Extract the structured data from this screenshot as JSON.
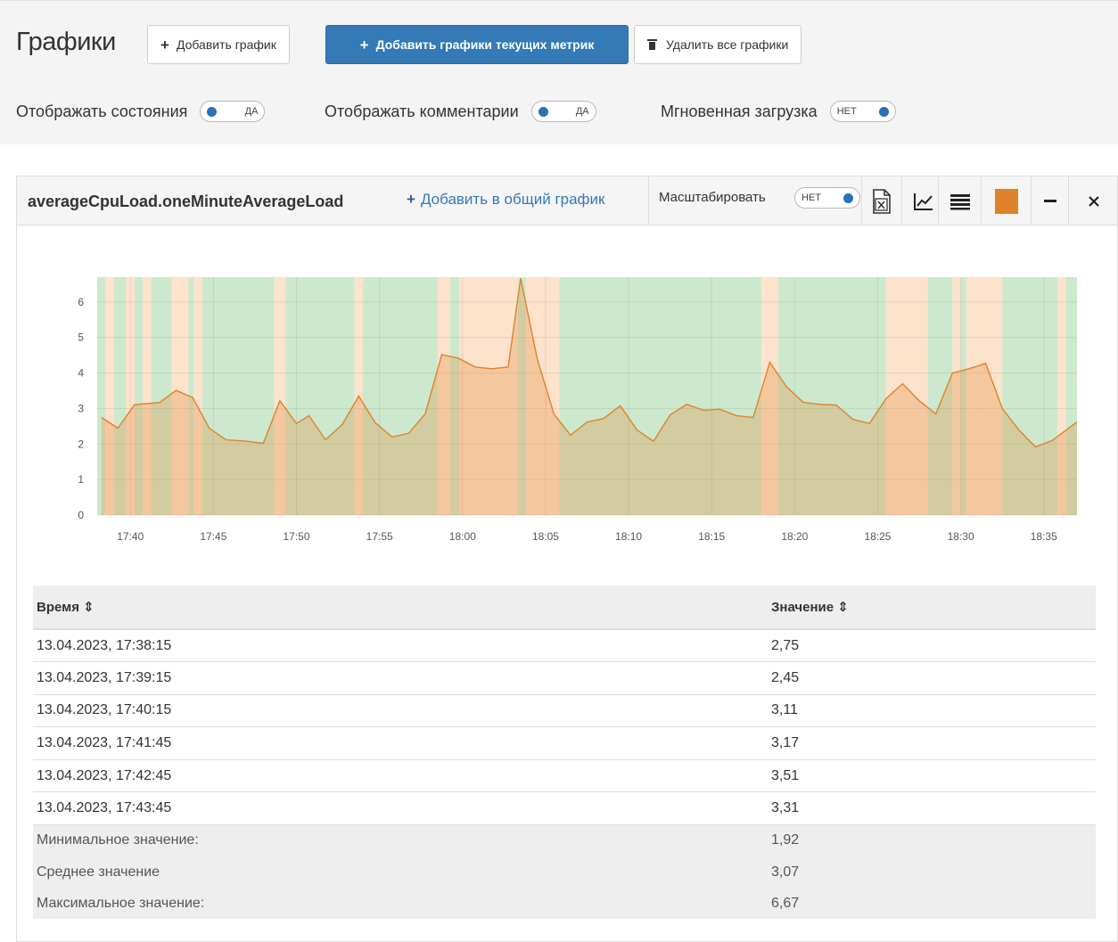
{
  "page": {
    "title": "Графики",
    "buttons": {
      "add_chart": "Добавить график",
      "add_current": "Добавить графики текущих метрик",
      "delete_all": "Удалить все графики"
    },
    "options": [
      {
        "label": "Отображать состояния",
        "state": "ДА"
      },
      {
        "label": "Отображать комментарии",
        "state": "ДА"
      },
      {
        "label": "Мгновенная загрузка",
        "state": "НЕТ"
      }
    ]
  },
  "panel": {
    "metric": "averageCpuLoad.oneMinuteAverageLoad",
    "add_to_common": "Добавить в общий график",
    "scale_label": "Масштабировать",
    "scale_state": "НЕТ",
    "tools": [
      "excel-export-icon",
      "line-chart-icon",
      "table-list-icon",
      "color-swatch-icon",
      "minimize-icon",
      "close-icon"
    ],
    "series_color": "#e0822a"
  },
  "chart_data": {
    "type": "area",
    "y_ticks": [
      "0",
      "1",
      "2",
      "3",
      "4",
      "5",
      "6"
    ],
    "ylim": [
      0,
      6.7
    ],
    "x_ticks": [
      "17:40",
      "17:45",
      "17:50",
      "17:55",
      "18:00",
      "18:05",
      "18:10",
      "18:15",
      "18:20",
      "18:25",
      "18:30",
      "18:35"
    ],
    "xlim": [
      "17:38",
      "18:37"
    ],
    "grid": true,
    "series": [
      {
        "color": "#e0822a",
        "points": [
          [
            "17:38:15",
            2.75
          ],
          [
            "17:39:15",
            2.45
          ],
          [
            "17:40:15",
            3.11
          ],
          [
            "17:41:45",
            3.17
          ],
          [
            "17:42:45",
            3.51
          ],
          [
            "17:43:45",
            3.31
          ],
          [
            "17:44:45",
            2.45
          ],
          [
            "17:45:45",
            2.12
          ],
          [
            "17:47:00",
            2.08
          ],
          [
            "17:48:00",
            2.02
          ],
          [
            "17:49:00",
            3.22
          ],
          [
            "17:50:00",
            2.58
          ],
          [
            "17:50:45",
            2.8
          ],
          [
            "17:51:45",
            2.12
          ],
          [
            "17:52:45",
            2.55
          ],
          [
            "17:53:45",
            3.35
          ],
          [
            "17:54:45",
            2.6
          ],
          [
            "17:55:45",
            2.2
          ],
          [
            "17:56:45",
            2.3
          ],
          [
            "17:57:45",
            2.85
          ],
          [
            "17:58:45",
            4.52
          ],
          [
            "17:59:45",
            4.42
          ],
          [
            "18:00:45",
            4.17
          ],
          [
            "18:01:45",
            4.12
          ],
          [
            "18:02:45",
            4.17
          ],
          [
            "18:03:30",
            6.67
          ],
          [
            "18:04:30",
            4.4
          ],
          [
            "18:05:30",
            2.85
          ],
          [
            "18:06:30",
            2.25
          ],
          [
            "18:07:30",
            2.62
          ],
          [
            "18:08:30",
            2.72
          ],
          [
            "18:09:30",
            3.08
          ],
          [
            "18:10:30",
            2.4
          ],
          [
            "18:11:30",
            2.08
          ],
          [
            "18:12:30",
            2.82
          ],
          [
            "18:13:30",
            3.12
          ],
          [
            "18:14:30",
            2.95
          ],
          [
            "18:15:30",
            2.98
          ],
          [
            "18:16:30",
            2.8
          ],
          [
            "18:17:30",
            2.75
          ],
          [
            "18:18:30",
            4.3
          ],
          [
            "18:19:30",
            3.62
          ],
          [
            "18:20:30",
            3.18
          ],
          [
            "18:21:30",
            3.12
          ],
          [
            "18:22:30",
            3.1
          ],
          [
            "18:23:30",
            2.7
          ],
          [
            "18:24:30",
            2.58
          ],
          [
            "18:25:30",
            3.28
          ],
          [
            "18:26:30",
            3.7
          ],
          [
            "18:27:30",
            3.22
          ],
          [
            "18:28:30",
            2.85
          ],
          [
            "18:29:30",
            4.0
          ],
          [
            "18:30:30",
            4.12
          ],
          [
            "18:31:30",
            4.27
          ],
          [
            "18:32:30",
            3.0
          ],
          [
            "18:33:30",
            2.4
          ],
          [
            "18:34:30",
            1.92
          ],
          [
            "18:35:30",
            2.1
          ],
          [
            "18:37:00",
            2.62
          ]
        ]
      }
    ],
    "state_bands": {
      "colors": {
        "ok": "#cde9cd",
        "warn": "#fde2cc"
      },
      "bands": [
        [
          "17:38:00",
          "17:38:30",
          "ok"
        ],
        [
          "17:38:30",
          "17:39:00",
          "warn"
        ],
        [
          "17:39:00",
          "17:39:45",
          "ok"
        ],
        [
          "17:39:45",
          "17:40:15",
          "warn"
        ],
        [
          "17:40:15",
          "17:40:45",
          "ok"
        ],
        [
          "17:40:45",
          "17:41:15",
          "warn"
        ],
        [
          "17:41:15",
          "17:42:30",
          "ok"
        ],
        [
          "17:42:30",
          "17:43:30",
          "warn"
        ],
        [
          "17:43:30",
          "17:43:50",
          "ok"
        ],
        [
          "17:43:50",
          "17:44:20",
          "warn"
        ],
        [
          "17:44:20",
          "17:48:40",
          "ok"
        ],
        [
          "17:48:40",
          "17:49:20",
          "warn"
        ],
        [
          "17:49:20",
          "17:53:30",
          "ok"
        ],
        [
          "17:53:30",
          "17:54:00",
          "warn"
        ],
        [
          "17:54:00",
          "17:58:30",
          "ok"
        ],
        [
          "17:58:30",
          "17:59:15",
          "warn"
        ],
        [
          "17:59:15",
          "17:59:50",
          "ok"
        ],
        [
          "17:59:50",
          "18:03:20",
          "warn"
        ],
        [
          "18:03:20",
          "18:03:50",
          "ok"
        ],
        [
          "18:03:50",
          "18:05:50",
          "warn"
        ],
        [
          "18:05:50",
          "18:18:00",
          "ok"
        ],
        [
          "18:18:00",
          "18:19:00",
          "warn"
        ],
        [
          "18:19:00",
          "18:20:00",
          "ok"
        ],
        [
          "18:20:00",
          "18:25:30",
          "ok"
        ],
        [
          "18:25:30",
          "18:28:00",
          "warn"
        ],
        [
          "18:28:00",
          "18:29:30",
          "ok"
        ],
        [
          "18:29:30",
          "18:30:00",
          "warn"
        ],
        [
          "18:30:00",
          "18:30:20",
          "ok"
        ],
        [
          "18:30:20",
          "18:31:00",
          "warn"
        ],
        [
          "18:31:00",
          "18:32:30",
          "warn"
        ],
        [
          "18:32:30",
          "18:35:50",
          "ok"
        ],
        [
          "18:35:50",
          "18:36:20",
          "warn"
        ],
        [
          "18:36:20",
          "18:37:00",
          "ok"
        ]
      ]
    }
  },
  "table": {
    "col_time": "Время ⇕",
    "col_value": "Значение ⇕",
    "rows": [
      {
        "time": "13.04.2023, 17:38:15",
        "value": "2,75"
      },
      {
        "time": "13.04.2023, 17:39:15",
        "value": "2,45"
      },
      {
        "time": "13.04.2023, 17:40:15",
        "value": "3,11"
      },
      {
        "time": "13.04.2023, 17:41:45",
        "value": "3,17"
      },
      {
        "time": "13.04.2023, 17:42:45",
        "value": "3,51"
      },
      {
        "time": "13.04.2023, 17:43:45",
        "value": "3,31"
      }
    ],
    "summary": [
      {
        "label": "Минимальное значение:",
        "value": "1,92"
      },
      {
        "label": "Среднее значение",
        "value": "3,07"
      },
      {
        "label": "Максимальное значение:",
        "value": "6,67"
      }
    ]
  }
}
